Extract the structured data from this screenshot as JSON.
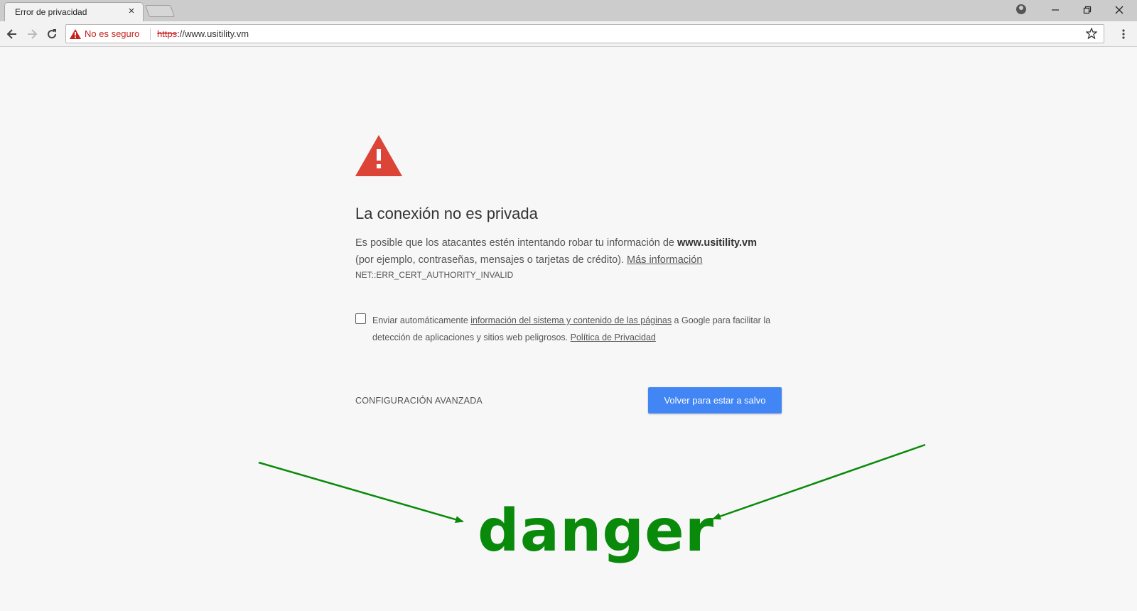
{
  "browser": {
    "tab": {
      "title": "Error de privacidad",
      "close_icon": "close-icon"
    },
    "address_bar": {
      "security_label": "No es seguro",
      "url_scheme": "https",
      "url_rest": "://www.usitility.vm"
    }
  },
  "page": {
    "heading": "La conexión no es privada",
    "body_prefix": "Es posible que los atacantes estén intentando robar tu información de ",
    "body_domain": "www.usitility.vm",
    "body_suffix": "(por ejemplo, contraseñas, mensajes o tarjetas de crédito). ",
    "more_info_link": "Más información",
    "error_code": "NET::ERR_CERT_AUTHORITY_INVALID",
    "optin": {
      "prefix": "Enviar automáticamente ",
      "link": "información del sistema y contenido de las páginas",
      "middle": " a Google para facilitar la detección de aplicaciones y sitios web peligrosos. ",
      "privacy_link": "Política de Privacidad"
    },
    "advanced_label": "CONFIGURACIÓN AVANZADA",
    "back_to_safety_label": "Volver para estar a salvo"
  },
  "annotation": {
    "label": "danger",
    "color": "#0a8a0a"
  },
  "colors": {
    "warning_red": "#db4437",
    "insecure_red": "#c5221f",
    "button_blue": "#4285f4"
  }
}
